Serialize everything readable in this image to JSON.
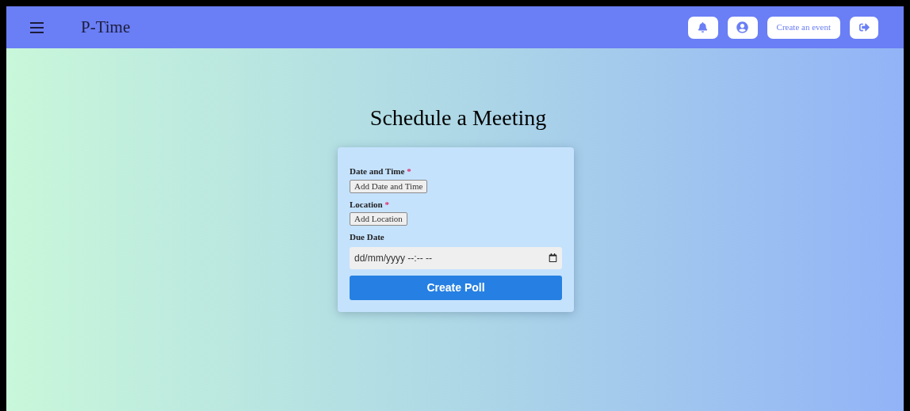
{
  "header": {
    "brand": "P-Time",
    "create_event": "Create an event"
  },
  "page": {
    "title": "Schedule a Meeting"
  },
  "form": {
    "fields": [
      {
        "kind": "button",
        "label": "Date and Time",
        "required_mark": "*",
        "button": "Add Date and Time"
      },
      {
        "kind": "button",
        "label": "Location",
        "required_mark": "*",
        "button": "Add Location"
      },
      {
        "kind": "datetime",
        "label": "Due Date",
        "placeholder": "dd/mm/yyyy --:-- --"
      }
    ],
    "submit": "Create Poll"
  }
}
